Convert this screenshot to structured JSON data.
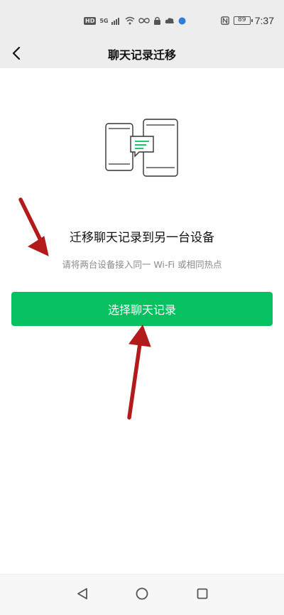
{
  "status_bar": {
    "tags": [
      "HD",
      "5G"
    ],
    "icons": [
      "signal-icon",
      "wifi-icon",
      "infinity-icon",
      "lock-icon",
      "cloud-icon",
      "app-icon"
    ],
    "nfc_icon": "nfc-icon",
    "battery": "89",
    "time": "7:37"
  },
  "nav": {
    "back_icon": "back-chevron-icon",
    "title": "聊天记录迁移"
  },
  "main": {
    "illustration_icon": "two-phones-chat-icon",
    "headline": "迁移聊天记录到另一台设备",
    "subtext": "请将两台设备接入同一 Wi-Fi 或相同热点",
    "button_label": "选择聊天记录"
  },
  "annotations": {
    "arrow_color": "#b31b1b"
  },
  "theme": {
    "accent": "#07c160",
    "bar_bg": "#ededed"
  },
  "system_nav": {
    "back": "triangle-back-icon",
    "home": "circle-home-icon",
    "recent": "square-recent-icon"
  }
}
